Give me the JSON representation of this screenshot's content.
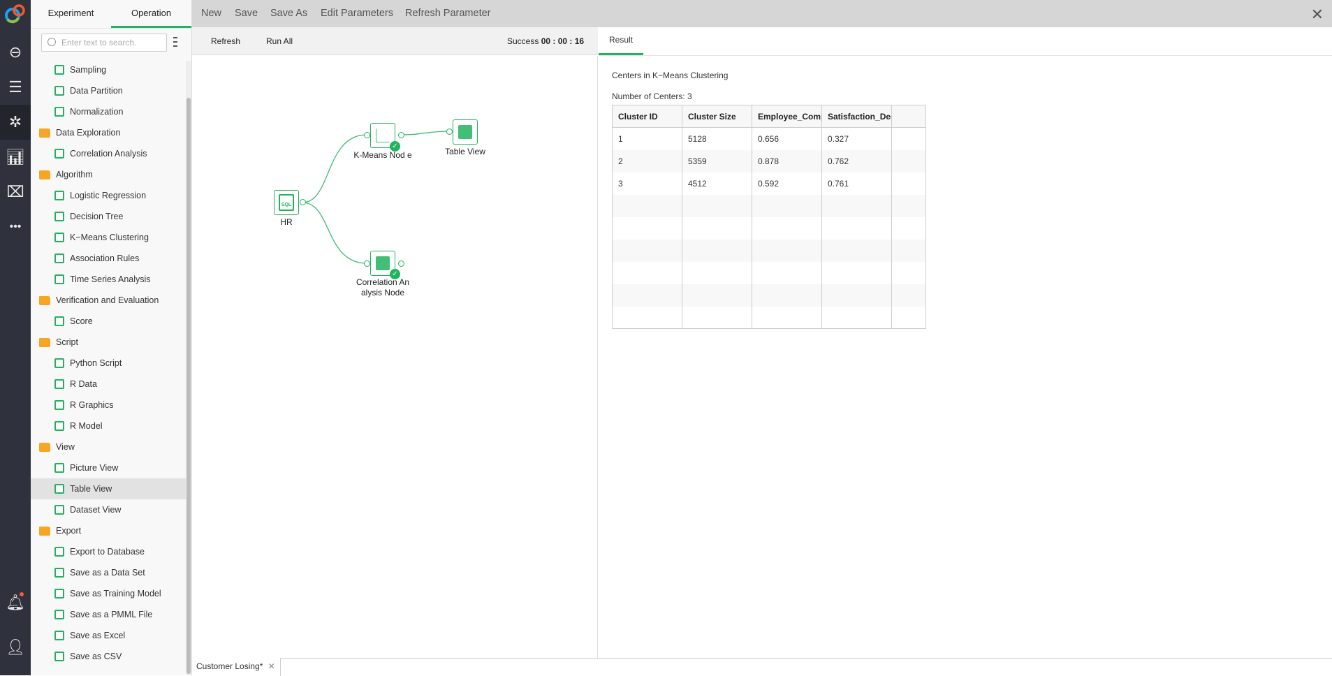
{
  "rail": {
    "icons": [
      "logo-icon",
      "link-icon",
      "dashboard-icon",
      "workflow-icon",
      "chart-icon",
      "presentation-icon",
      "more-icon",
      "bell-icon",
      "user-icon"
    ],
    "more_label": "•••"
  },
  "sidebar": {
    "tabs": [
      {
        "label": "Experiment"
      },
      {
        "label": "Operation"
      }
    ],
    "search_placeholder": "Enter text to search.",
    "items": [
      {
        "label": "Sampling",
        "type": "item"
      },
      {
        "label": "Data Partition",
        "type": "item"
      },
      {
        "label": "Normalization",
        "type": "item"
      },
      {
        "label": "Data Exploration",
        "type": "folder"
      },
      {
        "label": "Correlation Analysis",
        "type": "item"
      },
      {
        "label": "Algorithm",
        "type": "folder"
      },
      {
        "label": "Logistic Regression",
        "type": "item"
      },
      {
        "label": "Decision Tree",
        "type": "item"
      },
      {
        "label": "K−Means Clustering",
        "type": "item"
      },
      {
        "label": "Association Rules",
        "type": "item"
      },
      {
        "label": "Time Series Analysis",
        "type": "item"
      },
      {
        "label": "Verification and Evaluation",
        "type": "folder"
      },
      {
        "label": "Score",
        "type": "item"
      },
      {
        "label": "Script",
        "type": "folder"
      },
      {
        "label": "Python Script",
        "type": "item"
      },
      {
        "label": "R Data",
        "type": "item"
      },
      {
        "label": "R Graphics",
        "type": "item"
      },
      {
        "label": "R Model",
        "type": "item"
      },
      {
        "label": "View",
        "type": "folder"
      },
      {
        "label": "Picture View",
        "type": "item"
      },
      {
        "label": "Table View",
        "type": "item",
        "selected": true
      },
      {
        "label": "Dataset View",
        "type": "item"
      },
      {
        "label": "Export",
        "type": "folder"
      },
      {
        "label": "Export to Database",
        "type": "item"
      },
      {
        "label": "Save as a Data Set",
        "type": "item"
      },
      {
        "label": "Save as Training Model",
        "type": "item"
      },
      {
        "label": "Save as a PMML File",
        "type": "item"
      },
      {
        "label": "Save as Excel",
        "type": "item"
      },
      {
        "label": "Save as CSV",
        "type": "item"
      }
    ]
  },
  "toolbar": {
    "new": "New",
    "save": "Save",
    "save_as": "Save As",
    "edit_parameters": "Edit Parameters",
    "refresh_parameter": "Refresh Parameter",
    "close": "✕"
  },
  "canvas_toolbar": {
    "refresh": "Refresh",
    "run_all": "Run All",
    "status": "Success",
    "time": "00 : 00 : 16"
  },
  "nodes": {
    "hr": "HR",
    "hr_icon_text": "SQL",
    "kmeans": "K-Means Nod e",
    "table_view": "Table View",
    "correlation": "Correlation An alysis  Node"
  },
  "result": {
    "tab": "Result",
    "title": "Centers in K−Means Clustering",
    "count": "Number of Centers: 3",
    "columns": [
      "Cluster ID",
      "Cluster Size",
      "Employee_Comp",
      "Satisfaction_Deg"
    ],
    "rows": [
      [
        "1",
        "5128",
        "0.656",
        "0.327"
      ],
      [
        "2",
        "5359",
        "0.878",
        "0.762"
      ],
      [
        "3",
        "4512",
        "0.592",
        "0.761"
      ]
    ]
  },
  "bottom_tabs": [
    {
      "label": "Customer Losing*",
      "close": "✕"
    }
  ],
  "colors": {
    "accent": "#22b35e",
    "folder": "#f5a623",
    "rail": "#2f323d"
  }
}
